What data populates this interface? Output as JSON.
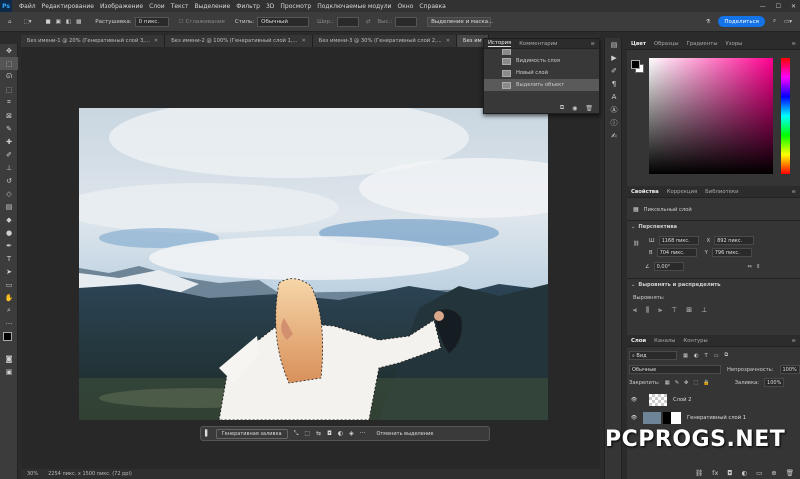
{
  "menu": {
    "logo": "Ps",
    "items": [
      "Файл",
      "Редактирование",
      "Изображение",
      "Слои",
      "Текст",
      "Выделение",
      "Фильтр",
      "3D",
      "Просмотр",
      "Подключаемые модули",
      "Окно",
      "Справка"
    ]
  },
  "options": {
    "feather_label": "Растушевка:",
    "feather_value": "0 пикс.",
    "antialias_label": "Сглаживание",
    "style_label": "Стиль:",
    "style_value": "Обычный",
    "width_label": "Шир.:",
    "height_label": "Выс.:",
    "select_mask": "Выделение и маска...",
    "share": "Поделиться"
  },
  "tabs": [
    {
      "label": "Без имени-1 @ 20% (Генеративный слой 3,...",
      "active": false
    },
    {
      "label": "Без имени-2 @ 100% (Генеративный слой 1,...",
      "active": false
    },
    {
      "label": "Без имени-3 @ 30% (Генеративный слой 2,...",
      "active": false
    },
    {
      "label": "Без им",
      "active": true
    }
  ],
  "history": {
    "tabs": [
      "История",
      "Комментарии"
    ],
    "items": [
      {
        "label": "Видимость слоя",
        "selected": false
      },
      {
        "label": "Новый слой",
        "selected": false
      },
      {
        "label": "Выделить объект",
        "selected": true
      }
    ]
  },
  "context_bar": {
    "generative_fill": "Генеративная заливка",
    "deselect": "Отменить выделение"
  },
  "status": {
    "zoom": "30%",
    "doc_info": "2254 пикс. x 1500 пикс. (72 ppi)"
  },
  "color_panel": {
    "tabs": [
      "Цвет",
      "Образцы",
      "Градиенты",
      "Узоры"
    ],
    "base_hue": "#ff0090"
  },
  "properties": {
    "tabs": [
      "Свойства",
      "Коррекция",
      "Библиотеки"
    ],
    "layer_type": "Пиксельный слой",
    "transform_title": "Перспектива",
    "w_label": "Ш",
    "w_value": "1168 пикс.",
    "h_label": "В",
    "h_value": "704 пикс.",
    "x_label": "X",
    "x_value": "892 пикс.",
    "y_label": "Y",
    "y_value": "796 пикс.",
    "angle_value": "0,00°",
    "align_title": "Выровнять и распределить",
    "align_label": "Выровнять:"
  },
  "layers": {
    "tabs": [
      "Слои",
      "Каналы",
      "Контуры"
    ],
    "kind_filter": "Вид",
    "blend_mode": "Обычные",
    "opacity_label": "Непрозрачность:",
    "opacity_value": "100%",
    "lock_label": "Закрепить:",
    "fill_label": "Заливка:",
    "fill_value": "100%",
    "items": [
      {
        "name": "Слой 2"
      },
      {
        "name": "Генеративный слой 1"
      }
    ]
  },
  "watermark": "PCPROGS.NET"
}
